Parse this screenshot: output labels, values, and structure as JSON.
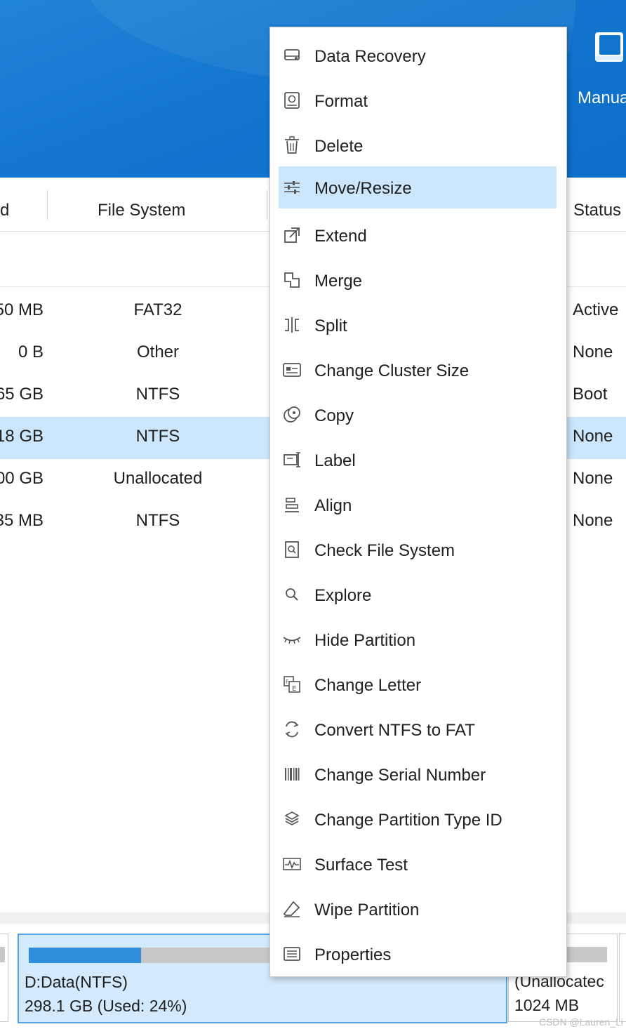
{
  "toolbar": {
    "manual_label": "Manua"
  },
  "columns": {
    "used": "d",
    "file_system": "File System",
    "status": "Status"
  },
  "rows": [
    {
      "used": "50 MB",
      "fs": "FAT32",
      "status": "Active"
    },
    {
      "used": "0 B",
      "fs": "Other",
      "status": "None"
    },
    {
      "used": "65 GB",
      "fs": "NTFS",
      "status": "Boot"
    },
    {
      "used": "18 GB",
      "fs": "NTFS",
      "status": "None"
    },
    {
      "used": "00 GB",
      "fs": "Unallocated",
      "status": "None"
    },
    {
      "used": "35 MB",
      "fs": "NTFS",
      "status": "None"
    }
  ],
  "selected_row": 3,
  "disk_map": {
    "partition_d": {
      "name": "D:Data(NTFS)",
      "size": "298.1 GB (Used: 24%)",
      "used_fraction": 0.24
    },
    "partition_unalloc": {
      "name": "(Unallocatec",
      "size": "1024 MB"
    }
  },
  "watermark": "CSDN @Lauren_Li",
  "context_menu": {
    "highlighted_index": 3,
    "items": [
      {
        "label": "Data Recovery",
        "icon": "drive-recovery-icon"
      },
      {
        "label": "Format",
        "icon": "format-icon"
      },
      {
        "label": "Delete",
        "icon": "trash-icon"
      },
      {
        "label": "Move/Resize",
        "icon": "sliders-icon"
      },
      {
        "label": "Extend",
        "icon": "extend-icon"
      },
      {
        "label": "Merge",
        "icon": "merge-icon"
      },
      {
        "label": "Split",
        "icon": "split-icon"
      },
      {
        "label": "Change Cluster Size",
        "icon": "cluster-icon"
      },
      {
        "label": "Copy",
        "icon": "copy-disk-icon"
      },
      {
        "label": "Label",
        "icon": "label-icon"
      },
      {
        "label": "Align",
        "icon": "align-icon"
      },
      {
        "label": "Check File System",
        "icon": "check-file-icon"
      },
      {
        "label": "Explore",
        "icon": "magnifier-icon"
      },
      {
        "label": "Hide Partition",
        "icon": "closed-eye-icon"
      },
      {
        "label": "Change Letter",
        "icon": "change-letter-icon"
      },
      {
        "label": "Convert NTFS to FAT",
        "icon": "convert-icon"
      },
      {
        "label": "Change Serial Number",
        "icon": "barcode-icon"
      },
      {
        "label": "Change Partition Type ID",
        "icon": "layers-icon"
      },
      {
        "label": "Surface Test",
        "icon": "pulse-icon"
      },
      {
        "label": "Wipe Partition",
        "icon": "eraser-icon"
      },
      {
        "label": "Properties",
        "icon": "properties-icon"
      }
    ]
  },
  "colors": {
    "header_blue": "#1276cf",
    "selection": "#cce6fb",
    "bar_fill": "#2f8ddc"
  }
}
